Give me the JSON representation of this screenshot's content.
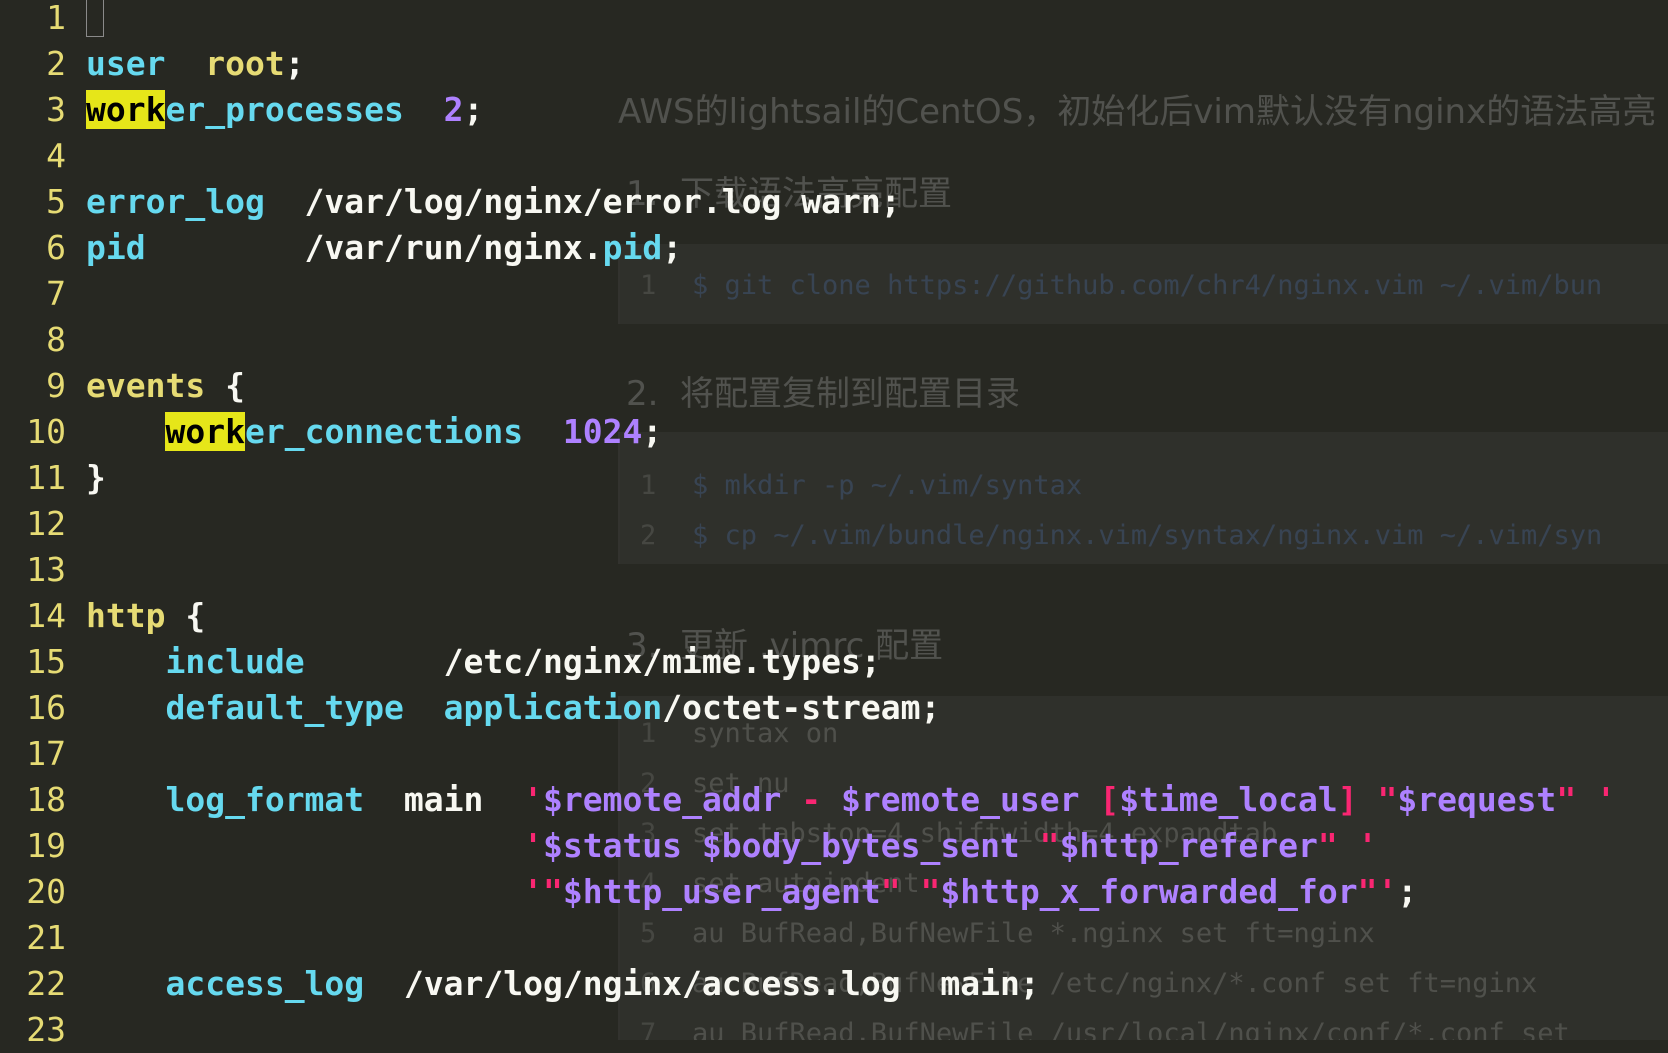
{
  "background_page": {
    "intro": "AWS的lightsail的CentOS，初始化后vim默认没有nginx的语法高亮",
    "step1": "1.  下载语法高亮配置",
    "step1_code": [
      "$ git clone https://github.com/chr4/nginx.vim ~/.vim/bun"
    ],
    "step2": "2.  将配置复制到配置目录",
    "step2_code": [
      "$ mkdir -p ~/.vim/syntax",
      "$ cp ~/.vim/bundle/nginx.vim/syntax/nginx.vim ~/.vim/syn"
    ],
    "step3": "3.  更新 .vimrc 配置",
    "step3_code": [
      "syntax on",
      "set nu",
      "set tabstop=4 shiftwidth=4 expandtab",
      "set autoindent",
      "au BufRead,BufNewFile *.nginx set ft=nginx",
      "au BufRead,BufNewFile /etc/nginx/*.conf set ft=nginx",
      "au BufRead,BufNewFile /usr/local/nginx/conf/*.conf set"
    ],
    "line_numbers": [
      "1",
      "1",
      "2",
      "1",
      "2",
      "3",
      "4",
      "5",
      "6",
      "7"
    ]
  },
  "editor": {
    "search_term": "work",
    "lines": [
      {
        "num": "1",
        "tokens": []
      },
      {
        "num": "2",
        "tokens": [
          [
            "k",
            "user"
          ],
          [
            "w",
            "  "
          ],
          [
            "y",
            "root"
          ],
          [
            "w",
            ";"
          ]
        ]
      },
      {
        "num": "3",
        "tokens": [
          [
            "hl",
            "work"
          ],
          [
            "k",
            "er_processes"
          ],
          [
            "w",
            "  "
          ],
          [
            "n",
            "2"
          ],
          [
            "w",
            ";"
          ]
        ]
      },
      {
        "num": "4",
        "tokens": []
      },
      {
        "num": "5",
        "tokens": [
          [
            "k",
            "error_log"
          ],
          [
            "w",
            "  /var/log/nginx/error.log warn;"
          ]
        ]
      },
      {
        "num": "6",
        "tokens": [
          [
            "k",
            "pid"
          ],
          [
            "w",
            "        /var/run/nginx."
          ],
          [
            "k",
            "pid"
          ],
          [
            "w",
            ";"
          ]
        ]
      },
      {
        "num": "7",
        "tokens": []
      },
      {
        "num": "8",
        "tokens": []
      },
      {
        "num": "9",
        "tokens": [
          [
            "y",
            "events"
          ],
          [
            "w",
            " {"
          ]
        ]
      },
      {
        "num": "10",
        "tokens": [
          [
            "w",
            "    "
          ],
          [
            "hl",
            "work"
          ],
          [
            "k",
            "er_connections"
          ],
          [
            "w",
            "  "
          ],
          [
            "n",
            "1024"
          ],
          [
            "w",
            ";"
          ]
        ]
      },
      {
        "num": "11",
        "tokens": [
          [
            "w",
            "}"
          ]
        ]
      },
      {
        "num": "12",
        "tokens": []
      },
      {
        "num": "13",
        "tokens": []
      },
      {
        "num": "14",
        "tokens": [
          [
            "y",
            "http"
          ],
          [
            "w",
            " {"
          ]
        ]
      },
      {
        "num": "15",
        "tokens": [
          [
            "w",
            "    "
          ],
          [
            "k",
            "include"
          ],
          [
            "w",
            "       /etc/nginx/mime.types;"
          ]
        ]
      },
      {
        "num": "16",
        "tokens": [
          [
            "w",
            "    "
          ],
          [
            "k",
            "default_type"
          ],
          [
            "w",
            "  "
          ],
          [
            "k",
            "application"
          ],
          [
            "w",
            "/octet-stream;"
          ]
        ]
      },
      {
        "num": "17",
        "tokens": []
      },
      {
        "num": "18",
        "tokens": [
          [
            "w",
            "    "
          ],
          [
            "k",
            "log_format"
          ],
          [
            "w",
            "  main  "
          ],
          [
            "m",
            "'"
          ],
          [
            "n",
            "$remote_addr"
          ],
          [
            "m",
            " - "
          ],
          [
            "n",
            "$remote_user"
          ],
          [
            "m",
            " ["
          ],
          [
            "n",
            "$time_local"
          ],
          [
            "m",
            "] \""
          ],
          [
            "n",
            "$request"
          ],
          [
            "m",
            "\" '"
          ]
        ]
      },
      {
        "num": "19",
        "tokens": [
          [
            "w",
            "                      "
          ],
          [
            "m",
            "'"
          ],
          [
            "n",
            "$status"
          ],
          [
            "w",
            " "
          ],
          [
            "n",
            "$body_bytes_sent"
          ],
          [
            "m",
            " \""
          ],
          [
            "n",
            "$http_referer"
          ],
          [
            "m",
            "\" '"
          ]
        ]
      },
      {
        "num": "20",
        "tokens": [
          [
            "w",
            "                      "
          ],
          [
            "m",
            "'\""
          ],
          [
            "n",
            "$http_user_agent"
          ],
          [
            "m",
            "\" \""
          ],
          [
            "n",
            "$http_x_forwarded_for"
          ],
          [
            "m",
            "\"'"
          ],
          [
            "w",
            ";"
          ]
        ]
      },
      {
        "num": "21",
        "tokens": []
      },
      {
        "num": "22",
        "tokens": [
          [
            "w",
            "    "
          ],
          [
            "k",
            "access_log"
          ],
          [
            "w",
            "  /var/log/nginx/access.log  main;"
          ]
        ]
      },
      {
        "num": "23",
        "tokens": []
      }
    ]
  }
}
